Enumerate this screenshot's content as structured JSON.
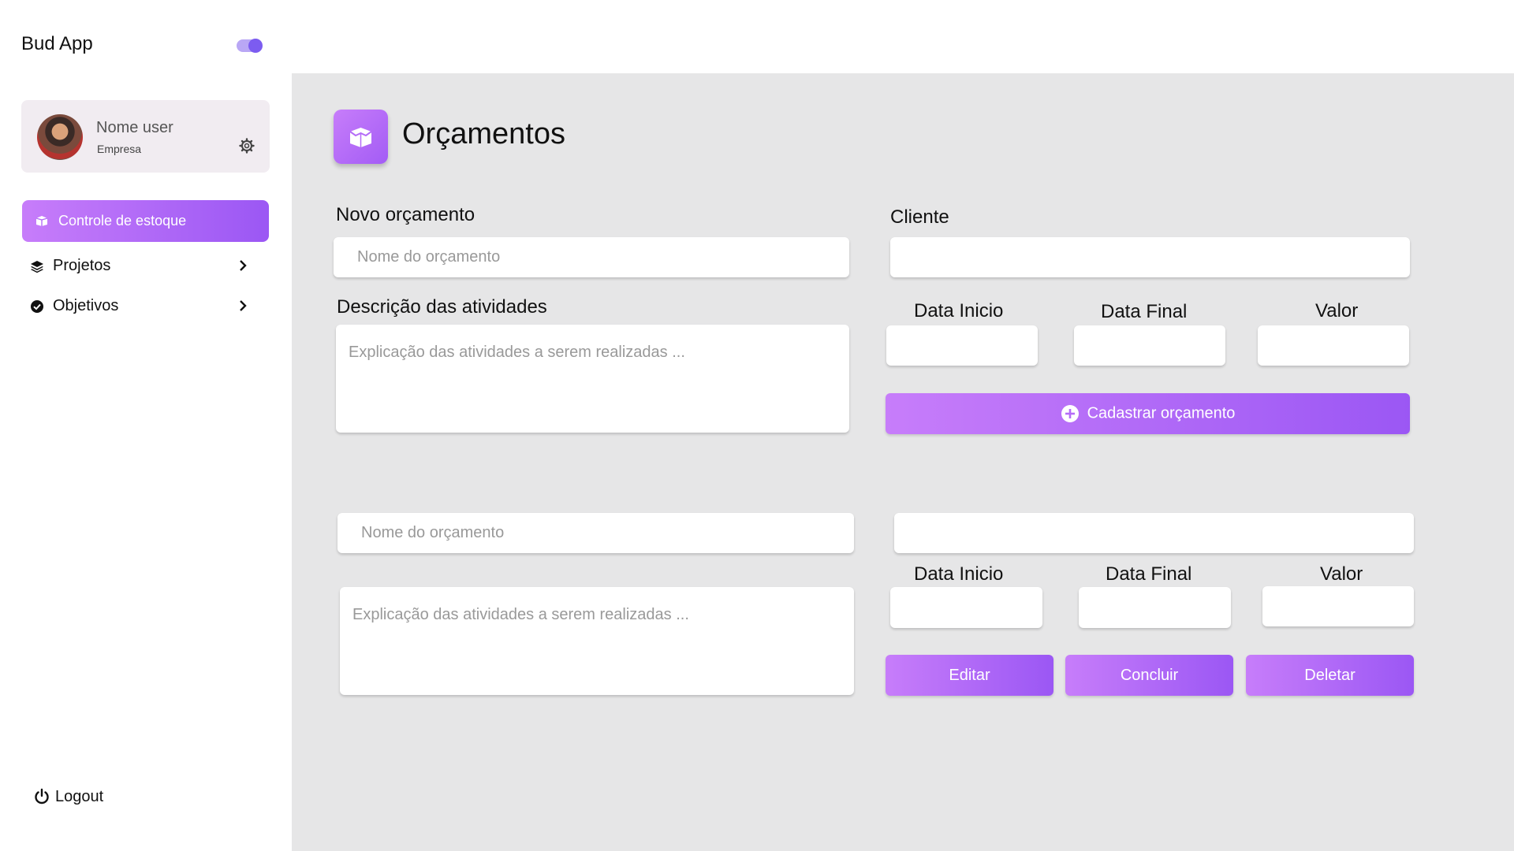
{
  "app": {
    "title": "Bud App"
  },
  "user": {
    "name": "Nome user",
    "company": "Empresa"
  },
  "sidebar": {
    "items": [
      {
        "label": "Controle de estoque",
        "active": true
      },
      {
        "label": "Projetos"
      },
      {
        "label": "Objetivos"
      }
    ],
    "logout_label": "Logout"
  },
  "page": {
    "title": "Orçamentos"
  },
  "form": {
    "novo_label": "Novo orçamento",
    "nome_placeholder": "Nome do orçamento",
    "descricao_label": "Descrição das atividades",
    "descricao_placeholder": "Explicação das atividades a serem realizadas ...",
    "cliente_label": "Cliente",
    "data_inicio_label": "Data Inicio",
    "data_final_label": "Data Final",
    "valor_label": "Valor",
    "cadastrar_label": "Cadastrar orçamento"
  },
  "card": {
    "nome_placeholder": "Nome do orçamento",
    "descricao_placeholder": "Explicação das atividades a serem realizadas ...",
    "data_inicio_label": "Data Inicio",
    "data_final_label": "Data Final",
    "valor_label": "Valor",
    "editar_label": "Editar",
    "concluir_label": "Concluir",
    "deletar_label": "Deletar"
  },
  "colors": {
    "accent_start": "#c77dfa",
    "accent_end": "#9b57f4",
    "main_bg": "#e6e6e7",
    "toggle": "#7c5cf0"
  }
}
